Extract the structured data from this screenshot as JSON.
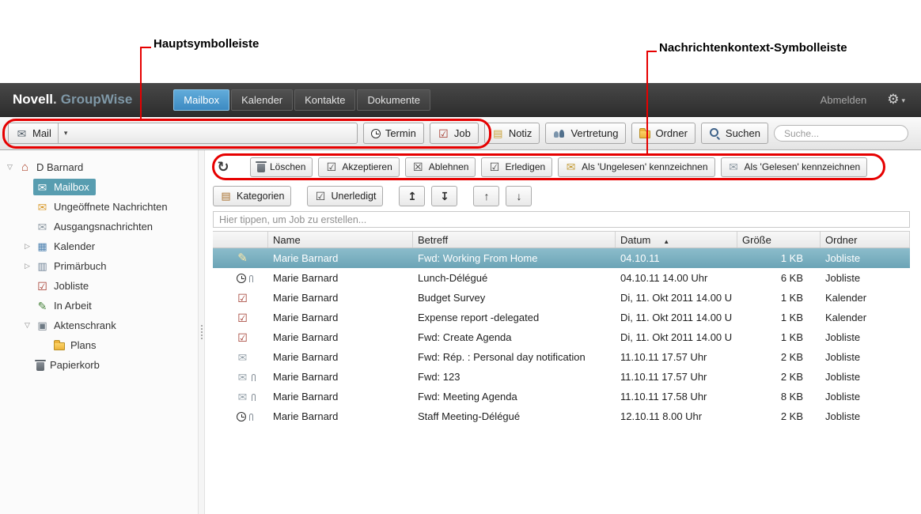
{
  "annotations": {
    "main_toolbar_callout": "Hauptsymbolleiste",
    "context_toolbar_callout": "Nachrichtenkontext-Symbolleiste",
    "callout_color": "#e60000"
  },
  "header": {
    "brand": {
      "name": "Novell",
      "dot": ".",
      "product": "GroupWise"
    },
    "tabs": [
      {
        "label": "Mailbox",
        "active": true
      },
      {
        "label": "Kalender",
        "active": false
      },
      {
        "label": "Kontakte",
        "active": false
      },
      {
        "label": "Dokumente",
        "active": false
      }
    ],
    "logout_label": "Abmelden",
    "gear_icon": "gear-icon"
  },
  "main_toolbar": {
    "buttons": [
      {
        "label": "Mail",
        "icon": "mail-icon",
        "split": true
      },
      {
        "label": "Termin",
        "icon": "clock-icon"
      },
      {
        "label": "Job",
        "icon": "task-icon"
      },
      {
        "label": "Notiz",
        "icon": "note-icon"
      },
      {
        "label": "Vertretung",
        "icon": "proxy-icon"
      },
      {
        "label": "Ordner",
        "icon": "folder-icon"
      },
      {
        "label": "Suchen",
        "icon": "search-icon"
      }
    ],
    "search_placeholder": "Suche..."
  },
  "sidebar": {
    "items": [
      {
        "label": "D Barnard",
        "icon": "home-icon",
        "level": 0,
        "expander": "open",
        "selected": false
      },
      {
        "label": "Mailbox",
        "icon": "mailbox-icon",
        "level": 1,
        "expander": "none",
        "selected": true
      },
      {
        "label": "Ungeöffnete Nachrichten",
        "icon": "unread-icon",
        "level": 1,
        "expander": "none",
        "selected": false
      },
      {
        "label": "Ausgangsnachrichten",
        "icon": "sent-icon",
        "level": 1,
        "expander": "none",
        "selected": false
      },
      {
        "label": "Kalender",
        "icon": "calendar-icon",
        "level": 1,
        "expander": "closed",
        "selected": false
      },
      {
        "label": "Primärbuch",
        "icon": "addressbook-icon",
        "level": 1,
        "expander": "closed",
        "selected": false
      },
      {
        "label": "Jobliste",
        "icon": "tasklist-icon",
        "level": 1,
        "expander": "none",
        "selected": false
      },
      {
        "label": "In Arbeit",
        "icon": "inprogress-icon",
        "level": 1,
        "expander": "none",
        "selected": false
      },
      {
        "label": "Aktenschrank",
        "icon": "cabinet-icon",
        "level": 1,
        "expander": "open",
        "selected": false
      },
      {
        "label": "Plans",
        "icon": "folder-icon",
        "level": 2,
        "expander": "none",
        "selected": false
      },
      {
        "label": "Papierkorb",
        "icon": "trash-icon",
        "level": 1,
        "expander": "none",
        "selected": false
      }
    ]
  },
  "context_toolbar": {
    "refresh_icon": "refresh-icon",
    "buttons": [
      {
        "label": "Löschen",
        "icon": "trash-icon"
      },
      {
        "label": "Akzeptieren",
        "icon": "accept-icon"
      },
      {
        "label": "Ablehnen",
        "icon": "decline-icon"
      },
      {
        "label": "Erledigen",
        "icon": "complete-icon"
      },
      {
        "label": "Als 'Ungelesen' kennzeichnen",
        "icon": "unread-mark-icon"
      },
      {
        "label": "Als 'Gelesen' kennzeichnen",
        "icon": "read-mark-icon"
      }
    ]
  },
  "secondary_toolbar": {
    "buttons": [
      {
        "label": "Kategorien",
        "icon": "categories-icon",
        "gap_before": false
      },
      {
        "label": "Unerledigt",
        "icon": "uncomplete-icon",
        "gap_before": true
      },
      {
        "label": "",
        "icon": "move-top-icon",
        "gap_before": true
      },
      {
        "label": "",
        "icon": "move-bottom-icon",
        "gap_before": false
      },
      {
        "label": "",
        "icon": "move-up-icon",
        "gap_before": true
      },
      {
        "label": "",
        "icon": "move-down-icon",
        "gap_before": false
      }
    ]
  },
  "task_input": {
    "placeholder": "Hier tippen, um Job zu erstellen..."
  },
  "message_list": {
    "columns": {
      "name": "Name",
      "subject": "Betreff",
      "date": "Datum",
      "size": "Größe",
      "folder": "Ordner"
    },
    "sort": {
      "column": "Datum",
      "direction": "asc"
    },
    "rows": [
      {
        "type_icon": "pencil-icon",
        "attachment": false,
        "name": "Marie Barnard",
        "subject": "Fwd: Working From Home",
        "date": "04.10.11",
        "size": "1 KB",
        "folder": "Jobliste",
        "selected": true
      },
      {
        "type_icon": "clock-icon",
        "attachment": true,
        "name": "Marie Barnard",
        "subject": "Lunch-Délégué",
        "date": "04.10.11 14.00 Uhr",
        "size": "6 KB",
        "folder": "Jobliste",
        "selected": false
      },
      {
        "type_icon": "task-check-icon",
        "attachment": false,
        "name": "Marie Barnard",
        "subject": "Budget Survey",
        "date": "Di, 11. Okt 2011 14.00 U",
        "size": "1 KB",
        "folder": "Kalender",
        "selected": false
      },
      {
        "type_icon": "task-check-icon",
        "attachment": false,
        "name": "Marie Barnard",
        "subject": "Expense report -delegated",
        "date": "Di, 11. Okt 2011 14.00 U",
        "size": "1 KB",
        "folder": "Kalender",
        "selected": false
      },
      {
        "type_icon": "task-check-icon",
        "attachment": false,
        "name": "Marie Barnard",
        "subject": "Fwd: Create Agenda",
        "date": "Di, 11. Okt 2011 14.00 U",
        "size": "1 KB",
        "folder": "Jobliste",
        "selected": false
      },
      {
        "type_icon": "envelope-icon",
        "attachment": false,
        "name": "Marie Barnard",
        "subject": "Fwd: Rép. : Personal day notification",
        "date": "11.10.11 17.57 Uhr",
        "size": "2 KB",
        "folder": "Jobliste",
        "selected": false
      },
      {
        "type_icon": "envelope-icon",
        "attachment": true,
        "name": "Marie Barnard",
        "subject": "Fwd: 123",
        "date": "11.10.11 17.57 Uhr",
        "size": "2 KB",
        "folder": "Jobliste",
        "selected": false
      },
      {
        "type_icon": "envelope-icon",
        "attachment": true,
        "name": "Marie Barnard",
        "subject": "Fwd: Meeting Agenda",
        "date": "11.10.11 17.58 Uhr",
        "size": "8 KB",
        "folder": "Jobliste",
        "selected": false
      },
      {
        "type_icon": "clock-icon",
        "attachment": true,
        "name": "Marie Barnard",
        "subject": "Staff Meeting-Délégué",
        "date": "12.10.11 8.00 Uhr",
        "size": "2 KB",
        "folder": "Jobliste",
        "selected": false
      }
    ]
  },
  "icon_glyphs": {
    "mail-icon": "✉",
    "task-icon": "☑",
    "note-icon": "▤",
    "home-icon": "⌂",
    "mailbox-icon": "✉",
    "unread-icon": "✉",
    "sent-icon": "✉",
    "calendar-icon": "▦",
    "addressbook-icon": "▥",
    "tasklist-icon": "☑",
    "inprogress-icon": "✎",
    "cabinet-icon": "▣",
    "pencil-icon": "✎",
    "task-check-icon": "☑",
    "envelope-icon": "✉",
    "refresh-icon": "↻",
    "accept-icon": "☑",
    "decline-icon": "☒",
    "complete-icon": "☑",
    "unread-mark-icon": "✉",
    "read-mark-icon": "✉",
    "categories-icon": "▤",
    "uncomplete-icon": "☑",
    "move-top-icon": "↥",
    "move-bottom-icon": "↧",
    "move-up-icon": "↑",
    "move-down-icon": "↓"
  }
}
